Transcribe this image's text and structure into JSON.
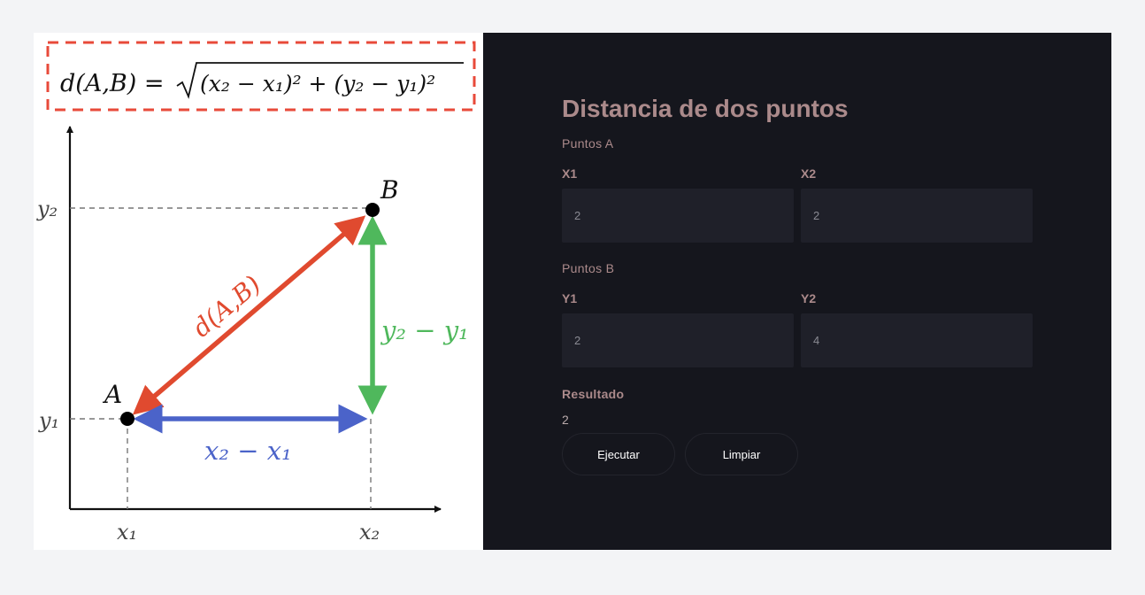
{
  "illustration": {
    "formula": {
      "lhs": "d(A,B) =",
      "radicand": "(x₂ − x₁)² + (y₂ − y₁)²"
    },
    "axis_labels": {
      "y2": "y₂",
      "y1": "y₁",
      "x1": "x₁",
      "x2": "x₂"
    },
    "point_a": "A",
    "point_b": "B",
    "distance_label": "d(A,B)",
    "dy_label": "y₂ − y₁",
    "dx_label": "x₂ − x₁",
    "colors": {
      "distance": "#e04a2f",
      "dy": "#4fb85c",
      "dx": "#4b63c9",
      "frame": "#e84a3a"
    }
  },
  "panel": {
    "title": "Distancia de dos puntos",
    "section_a": "Puntos A",
    "x1_label": "X1",
    "x1_value": "2",
    "x2_label": "X2",
    "x2_value": "2",
    "section_b": "Puntos B",
    "y1_label": "Y1",
    "y1_value": "2",
    "y2_label": "Y2",
    "y2_value": "4",
    "result_label": "Resultado",
    "result_value": "2",
    "run_button": "Ejecutar",
    "clear_button": "Limpiar"
  }
}
